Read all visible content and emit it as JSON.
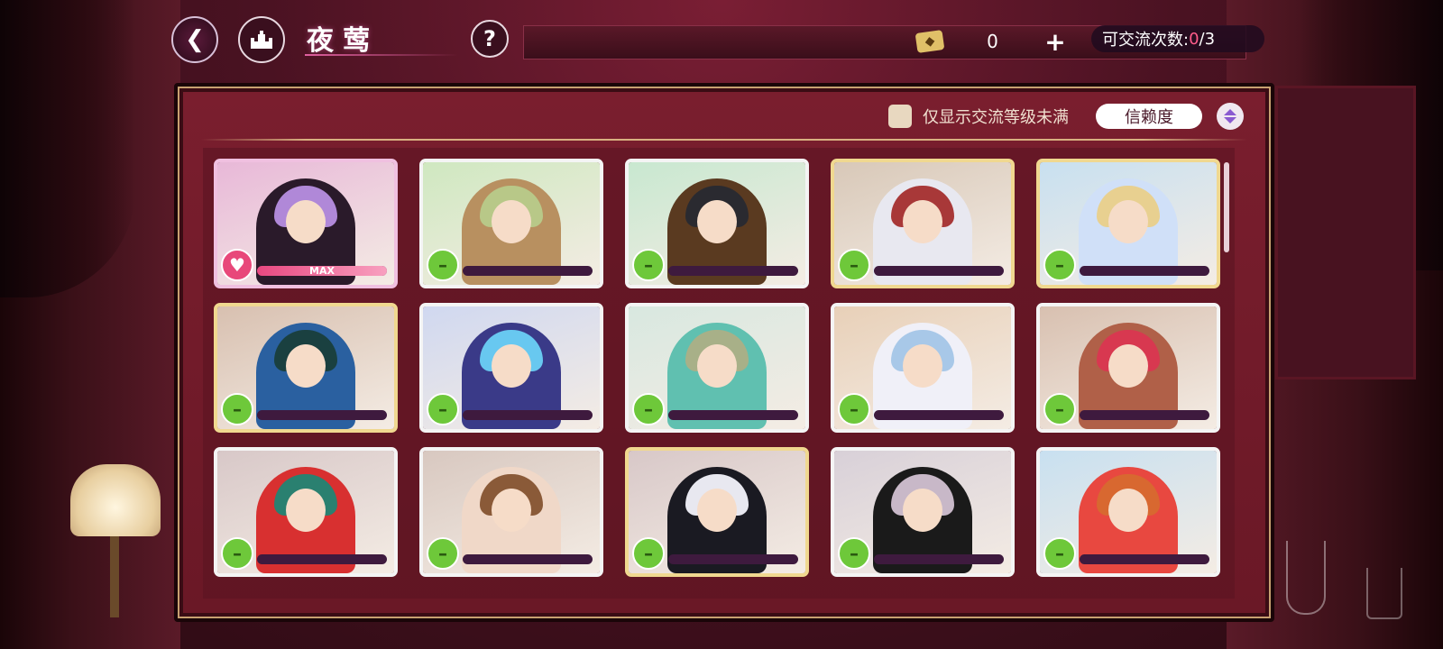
{
  "header": {
    "back_icon": "back-arrow-icon",
    "home_icon": "castle-icon",
    "title": "夜莺",
    "help_label": "?",
    "currency_value": "0",
    "plus_label": "+",
    "exchange_label": "可交流次数: ",
    "exchange_used": "0",
    "exchange_total": "/3"
  },
  "filter": {
    "checkbox_label": "仅显示交流等级未满",
    "checked": false,
    "sort_label": "信赖度"
  },
  "colors": {
    "accent_red": "#ff5c8a",
    "panel": "#6a1826",
    "bar_track": "#3e1a3e",
    "mood_green": "#6ec83a",
    "mood_pink": "#e8487a"
  },
  "characters": [
    {
      "mood": "love",
      "bar_label": "MAX",
      "fill": 1.0,
      "border": "#f0c0e0",
      "bg": "#e8b8d8",
      "hair": "#b088d8",
      "outfit": "#2a1a2a"
    },
    {
      "mood": "neutral",
      "bar_label": "",
      "fill": 0.0,
      "border": "#f4f4f4",
      "bg": "#cfe8c0",
      "hair": "#b8c888",
      "outfit": "#b89060"
    },
    {
      "mood": "neutral",
      "bar_label": "",
      "fill": 0.0,
      "border": "#f4f4f4",
      "bg": "#c8e8d0",
      "hair": "#2a2a30",
      "outfit": "#5a3a20"
    },
    {
      "mood": "neutral",
      "bar_label": "",
      "fill": 0.0,
      "border": "#f0d890",
      "bg": "#d8c8b8",
      "hair": "#a83838",
      "outfit": "#e8e8f0"
    },
    {
      "mood": "neutral",
      "bar_label": "",
      "fill": 0.0,
      "border": "#f0d890",
      "bg": "#c8e0f0",
      "hair": "#e8d090",
      "outfit": "#d0e0f8"
    },
    {
      "mood": "neutral",
      "bar_label": "",
      "fill": 0.0,
      "border": "#f0d890",
      "bg": "#d8c0b0",
      "hair": "#1a4040",
      "outfit": "#2a60a0"
    },
    {
      "mood": "neutral",
      "bar_label": "",
      "fill": 0.0,
      "border": "#f4f4f4",
      "bg": "#d0d8f0",
      "hair": "#68c8f0",
      "outfit": "#3a3a88"
    },
    {
      "mood": "neutral",
      "bar_label": "",
      "fill": 0.0,
      "border": "#f4f4f4",
      "bg": "#d8e8e0",
      "hair": "#a8b088",
      "outfit": "#60c0b0"
    },
    {
      "mood": "neutral",
      "bar_label": "",
      "fill": 0.0,
      "border": "#f4f4f4",
      "bg": "#e8d0b8",
      "hair": "#a8c8e8",
      "outfit": "#f0f0f8"
    },
    {
      "mood": "neutral",
      "bar_label": "",
      "fill": 0.0,
      "border": "#f4f4f4",
      "bg": "#d8c0b0",
      "hair": "#d83850",
      "outfit": "#b06048"
    },
    {
      "mood": "neutral",
      "bar_label": "",
      "fill": 0.0,
      "border": "#f4f4f4",
      "bg": "#d8c8c8",
      "hair": "#2a8070",
      "outfit": "#d83030"
    },
    {
      "mood": "neutral",
      "bar_label": "",
      "fill": 0.0,
      "border": "#f4f4f4",
      "bg": "#d8c8c0",
      "hair": "#8a5a38",
      "outfit": "#f0d8c8"
    },
    {
      "mood": "neutral",
      "bar_label": "",
      "fill": 0.0,
      "border": "#f0d890",
      "bg": "#d8c8c8",
      "hair": "#e8e8f0",
      "outfit": "#1a1a22"
    },
    {
      "mood": "neutral",
      "bar_label": "",
      "fill": 0.0,
      "border": "#f4f4f4",
      "bg": "#d8d0d8",
      "hair": "#c8b8c8",
      "outfit": "#1a1a1a"
    },
    {
      "mood": "neutral",
      "bar_label": "",
      "fill": 0.0,
      "border": "#f4f4f4",
      "bg": "#c8e0f0",
      "hair": "#d86830",
      "outfit": "#e84840"
    }
  ]
}
